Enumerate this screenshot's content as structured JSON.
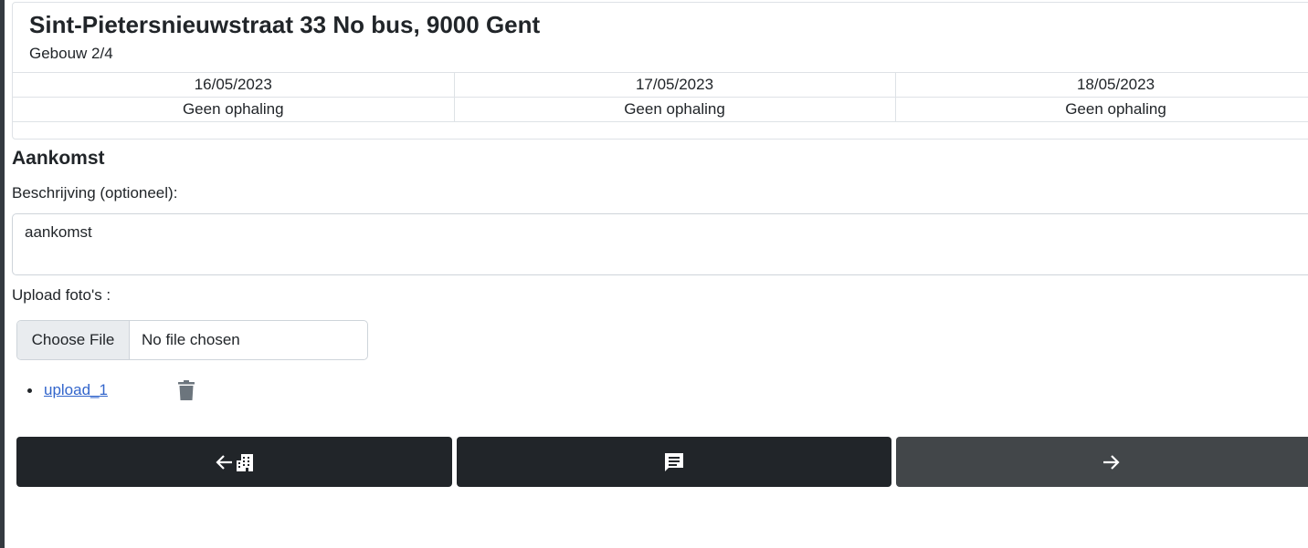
{
  "building": {
    "address": "Sint-Pietersnieuwstraat 33 No bus, 9000 Gent",
    "position": "Gebouw 2/4"
  },
  "schedule": {
    "dates": [
      "16/05/2023",
      "17/05/2023",
      "18/05/2023"
    ],
    "statuses": [
      "Geen ophaling",
      "Geen ophaling",
      "Geen ophaling"
    ]
  },
  "section": {
    "title": "Aankomst",
    "description_label": "Beschrijving (optioneel):",
    "description_value": "aankomst",
    "upload_label": "Upload foto's :",
    "file_button": "Choose File",
    "file_status": "No file chosen",
    "uploads": [
      {
        "name": "upload_1"
      }
    ]
  },
  "icons": {
    "back": "arrow-left-icon",
    "building": "building-icon",
    "comment": "comment-icon",
    "next": "arrow-right-icon",
    "delete": "trash-icon"
  },
  "colors": {
    "button_dark": "#212529",
    "button_next": "#424649",
    "link": "#3366cc"
  }
}
